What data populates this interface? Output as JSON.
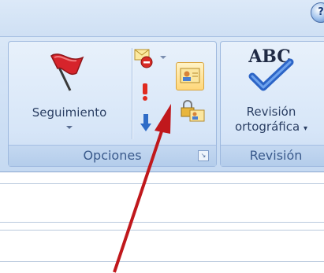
{
  "ribbon": {
    "help_icon": "help-icon",
    "groups": {
      "opciones": {
        "label": "Opciones",
        "seguimiento_label": "Seguimiento",
        "icons": [
          "flag-icon",
          "mail-delete-icon",
          "importance-high-icon",
          "importance-low-icon",
          "contact-card-icon",
          "lock-contact-icon"
        ]
      },
      "revision": {
        "label": "Revisión",
        "button_line1": "Revisión",
        "button_line2": "ortográfica",
        "icon": "abc-spellcheck-icon",
        "abc_text": "ABC"
      }
    }
  },
  "colors": {
    "ribbon_bg": "#d3e3f6",
    "group_label_text": "#3a5a8c",
    "highlight": "#ffd77a",
    "annotation_arrow": "#c0181c"
  }
}
